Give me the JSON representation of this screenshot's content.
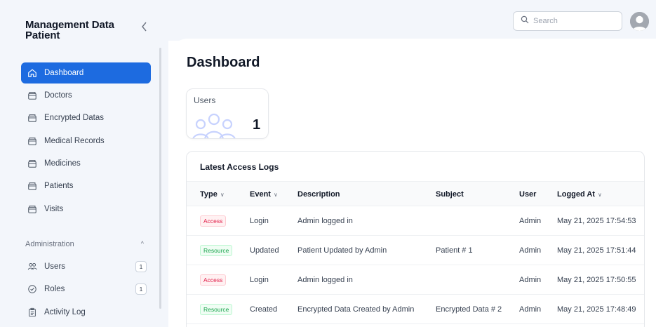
{
  "app": {
    "title": "Management Data Patient"
  },
  "sidebar": {
    "collapse_icon": "chevron-left-icon",
    "items": [
      {
        "label": "Dashboard",
        "icon": "home-icon",
        "active": true
      },
      {
        "label": "Doctors",
        "icon": "folder-icon"
      },
      {
        "label": "Encrypted Datas",
        "icon": "folder-icon"
      },
      {
        "label": "Medical Records",
        "icon": "folder-icon"
      },
      {
        "label": "Medicines",
        "icon": "folder-icon"
      },
      {
        "label": "Patients",
        "icon": "folder-icon"
      },
      {
        "label": "Visits",
        "icon": "folder-icon"
      }
    ],
    "admin_section": {
      "label": "Administration",
      "chevron": "^",
      "items": [
        {
          "label": "Users",
          "icon": "users-icon",
          "badge": "1"
        },
        {
          "label": "Roles",
          "icon": "shield-check-icon",
          "badge": "1"
        },
        {
          "label": "Activity Log",
          "icon": "clipboard-icon"
        }
      ]
    }
  },
  "header": {
    "search": {
      "placeholder": "Search",
      "icon": "search-icon"
    },
    "avatar_icon": "user-avatar-icon"
  },
  "main": {
    "title": "Dashboard",
    "stats": [
      {
        "label": "Users",
        "value": "1",
        "icon": "users-icon"
      }
    ],
    "logs": {
      "title": "Latest Access Logs",
      "columns": [
        {
          "label": "Type",
          "sortable": true
        },
        {
          "label": "Event",
          "sortable": true
        },
        {
          "label": "Description",
          "sortable": false
        },
        {
          "label": "Subject",
          "sortable": false
        },
        {
          "label": "User",
          "sortable": false
        },
        {
          "label": "Logged At",
          "sortable": true
        }
      ],
      "sort_glyph": "∨",
      "rows": [
        {
          "type": "Access",
          "event": "Login",
          "description": "Admin logged in",
          "subject": "",
          "user": "Admin",
          "logged_at": "May 21, 2025 17:54:53"
        },
        {
          "type": "Resource",
          "event": "Updated",
          "description": "Patient Updated by Admin",
          "subject": "Patient # 1",
          "user": "Admin",
          "logged_at": "May 21, 2025 17:51:44"
        },
        {
          "type": "Access",
          "event": "Login",
          "description": "Admin logged in",
          "subject": "",
          "user": "Admin",
          "logged_at": "May 21, 2025 17:50:55"
        },
        {
          "type": "Resource",
          "event": "Created",
          "description": "Encrypted Data Created by Admin",
          "subject": "Encrypted Data # 2",
          "user": "Admin",
          "logged_at": "May 21, 2025 17:48:49"
        }
      ]
    }
  },
  "colors": {
    "accent": "#1d6be0",
    "access_badge": "#e11d48",
    "resource_badge": "#16a34a",
    "sidebar_bg": "#f3f6fb"
  }
}
